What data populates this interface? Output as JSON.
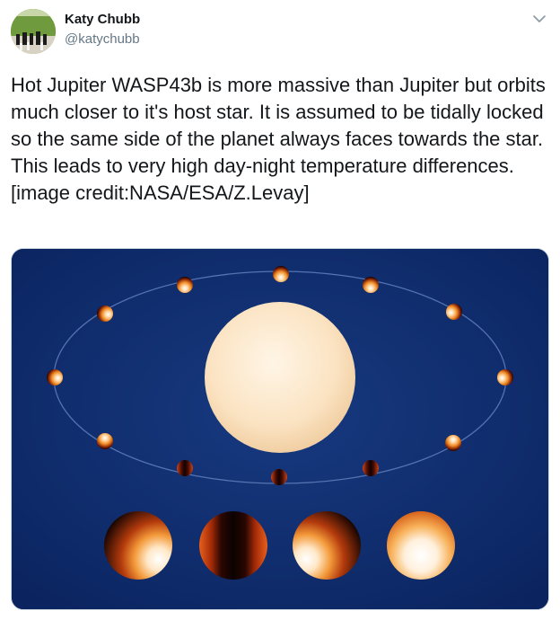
{
  "user": {
    "display_name": "Katy Chubb",
    "handle": "@katychubb",
    "avatar_icon": "avatar-chess-photo",
    "menu_icon": "chevron-down-icon"
  },
  "tweet": {
    "text": "Hot Jupiter WASP43b is more massive than Jupiter but orbits much closer to it's host star. It is assumed to be tidally locked so the same side of the planet always faces towards the star. This leads to very high day-night temperature differences. [image credit:NASA/ESA/Z.Levay]"
  },
  "media": {
    "background_color": "#0e2b6b",
    "star_color": "#fbe3c2",
    "orbit_color": "#5b7bb8",
    "planet_hot_color": "#ffffff",
    "planet_mid_color": "#f08a24",
    "planet_cold_color": "#1a0602"
  }
}
